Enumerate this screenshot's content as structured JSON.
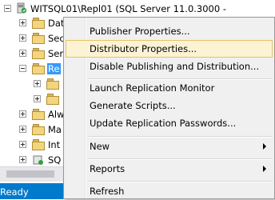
{
  "explorer": {
    "server_title": "WITSQL01\\Repl01 (SQL Server 11.0.3000 -",
    "nodes": [
      {
        "label": "Data"
      },
      {
        "label": "Sec"
      },
      {
        "label": "Ser"
      },
      {
        "label": "Re"
      },
      {
        "label": ""
      },
      {
        "label": ""
      },
      {
        "label": "Alw"
      },
      {
        "label": "Ma"
      },
      {
        "label": "Int"
      },
      {
        "label": "SQ"
      }
    ]
  },
  "context_menu": {
    "items": [
      {
        "label": "Publisher Properties..."
      },
      {
        "label": "Distributor Properties..."
      },
      {
        "label": "Disable Publishing and Distribution..."
      },
      {
        "label": "Launch Replication Monitor"
      },
      {
        "label": "Generate Scripts..."
      },
      {
        "label": "Update Replication Passwords..."
      },
      {
        "label": "New"
      },
      {
        "label": "Reports"
      },
      {
        "label": "Refresh"
      }
    ]
  },
  "status_bar": {
    "text": "Ready"
  }
}
